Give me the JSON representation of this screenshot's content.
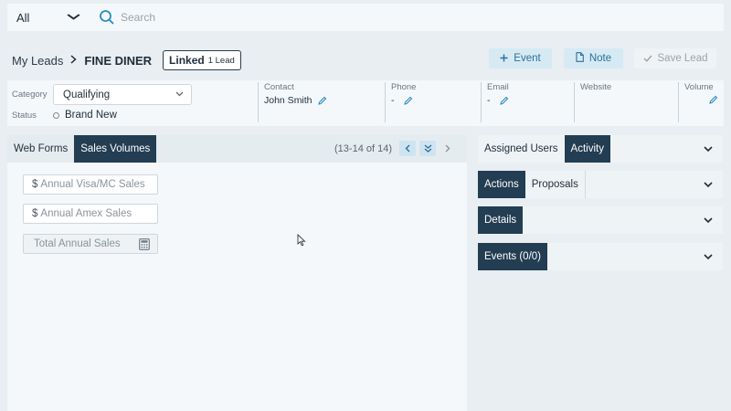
{
  "search": {
    "scope": "All",
    "placeholder": "Search"
  },
  "breadcrumb": {
    "parent": "My Leads",
    "current": "FINE DINER",
    "linked_label": "Linked",
    "linked_count": "1 Lead"
  },
  "actions": {
    "event": "Event",
    "note": "Note",
    "save": "Save Lead"
  },
  "info": {
    "category_label": "Category",
    "category_value": "Qualifying",
    "status_label": "Status",
    "status_value": "Brand New",
    "contact_label": "Contact",
    "contact_value": "John Smith",
    "phone_label": "Phone",
    "phone_value": "-",
    "email_label": "Email",
    "email_value": "-",
    "website_label": "Website",
    "volume_label": "Volume"
  },
  "left_tabs": {
    "web_forms": "Web Forms",
    "sales_volumes": "Sales Volumes",
    "pager_text": "(13-14 of 14)"
  },
  "sales_fields": {
    "visa_placeholder": "Annual Visa/MC Sales",
    "amex_placeholder": "Annual Amex Sales",
    "total_placeholder": "Total Annual Sales",
    "currency_symbol": "$"
  },
  "right_panels": {
    "assigned_users": "Assigned Users",
    "activity": "Activity",
    "actions": "Actions",
    "proposals": "Proposals",
    "details": "Details",
    "events": "Events (0/0)"
  },
  "colors": {
    "primary_dark": "#233d52",
    "accent_blue": "#2a6f9a",
    "accent_light": "#d6eaf4"
  }
}
